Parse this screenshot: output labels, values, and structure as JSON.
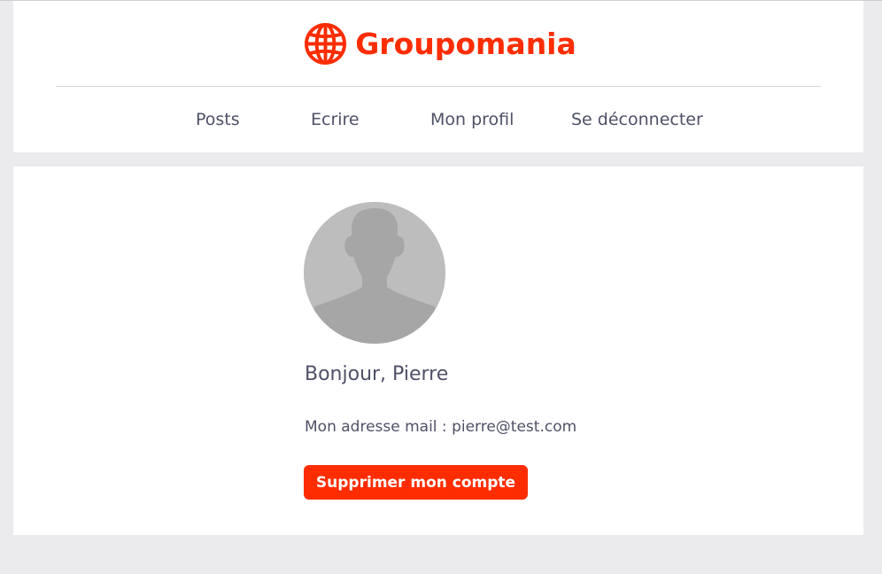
{
  "brand": {
    "name": "Groupomania",
    "icon": "globe-icon",
    "color": "#fd2d01"
  },
  "nav": {
    "items": [
      {
        "label": "Posts"
      },
      {
        "label": "Ecrire"
      },
      {
        "label": "Mon profil"
      },
      {
        "label": "Se déconnecter"
      }
    ]
  },
  "profile": {
    "avatar_icon": "default-user-avatar",
    "greeting": "Bonjour, Pierre",
    "email_line": "Mon adresse mail : pierre@test.com",
    "delete_button": "Supprimer mon compte"
  },
  "colors": {
    "accent": "#fd2d01",
    "text": "#4e5166",
    "background": "#ebebed"
  }
}
